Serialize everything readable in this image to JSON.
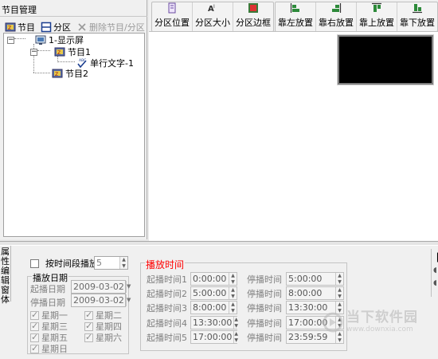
{
  "left_panel": {
    "title": "节目管理",
    "toolbar": {
      "program_label": "节目",
      "area_label": "分区",
      "delete_label": "删除节目/分区"
    },
    "tree": {
      "root": "1-显示屏",
      "program1": "节目1",
      "single_text": "单行文字-1",
      "program2": "节目2"
    }
  },
  "right_toolbar": {
    "area_position": "分区位置",
    "area_size": "分区大小",
    "area_border": "分区边框",
    "align_left": "靠左放置",
    "align_right": "靠右放置",
    "align_top": "靠上放置",
    "align_bottom": "靠下放置"
  },
  "properties": {
    "tab_label": [
      "属",
      "性",
      "编",
      "辑",
      "窗",
      "体"
    ],
    "time_segment_label": "按时间段播放",
    "time_segment_value": "5",
    "play_date": {
      "group_title": "播放日期",
      "start_label": "起播日期",
      "start_value": "2009-03-02",
      "stop_label": "停播日期",
      "stop_value": "2009-03-02"
    },
    "weekdays": [
      "星期一",
      "星期二",
      "星期三",
      "星期四",
      "星期五",
      "星期六",
      "星期日"
    ],
    "play_time": {
      "group_title": "播放时间",
      "rows": [
        {
          "start_label": "起播时间1",
          "start_value": "0:00:00",
          "stop_label": "停播时间",
          "stop_value": "5:00:00"
        },
        {
          "start_label": "起播时间2",
          "start_value": "5:00:00",
          "stop_label": "停播时间",
          "stop_value": "8:00:00"
        },
        {
          "start_label": "起播时间3",
          "start_value": "8:00:00",
          "stop_label": "停播时间",
          "stop_value": "13:30:00"
        },
        {
          "start_label": "起播时间4",
          "start_value": "13:30:00",
          "stop_label": "停播时间",
          "stop_value": "17:00:00"
        },
        {
          "start_label": "起播时间5",
          "start_value": "17:00:00",
          "stop_label": "停播时间",
          "stop_value": "23:59:59"
        }
      ]
    }
  },
  "watermark": {
    "cn": "当下软件园",
    "en": "www.downxia.com"
  },
  "colors": {
    "play_time_title": "#ff0000",
    "canvas_preview": "#000000"
  }
}
